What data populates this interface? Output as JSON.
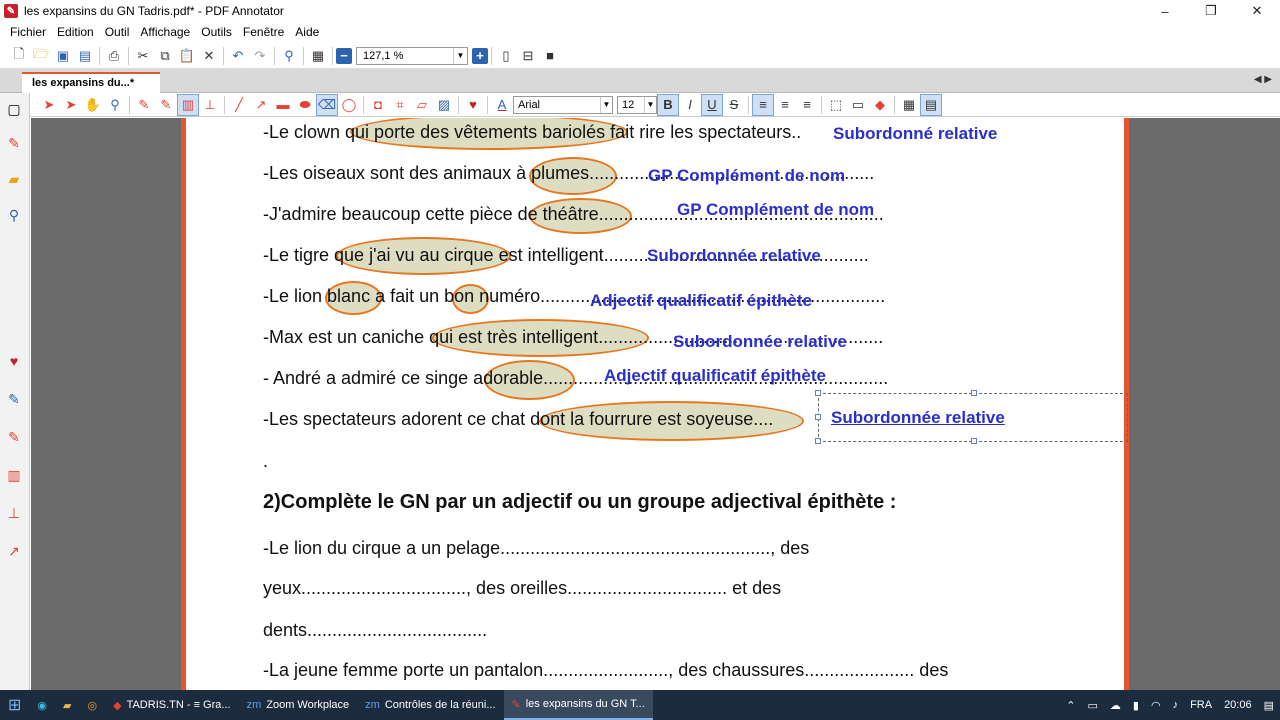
{
  "window": {
    "title": "les expansins du GN Tadris.pdf* - PDF Annotator",
    "controls": [
      "–",
      "❐",
      "✕"
    ]
  },
  "menu": [
    "Fichier",
    "Edition",
    "Outil",
    "Affichage",
    "Outils",
    "Fenêtre",
    "Aide"
  ],
  "toolbar": {
    "zoom_value": "127,1 %",
    "font_name": "Arial",
    "font_size": "12",
    "bold": "B",
    "italic": "I",
    "underline": "U",
    "strike": "S"
  },
  "tab": {
    "label": "les expansins du...*"
  },
  "document": {
    "lines": [
      "-Le clown qui porte des vêtements bariolés fait rire les spectateurs..",
      "-Les oiseaux sont des animaux à plumes.........................................................",
      "-J'admire beaucoup cette pièce de théâtre.........................................................",
      "-Le tigre que j'ai vu au cirque est intelligent.....................................................",
      "-Le lion blanc a fait un bon numéro.....................................................................",
      "-Max est un caniche qui est très intelligent.........................................................",
      "- André a admiré ce singe adorable.....................................................................",
      "-Les spectateurs adorent ce chat dont la fourrure est soyeuse....",
      "."
    ],
    "annotations": [
      "Subordonné relative",
      "GP Complément de nom",
      "GP Complément de nom",
      "Subordonnée relative",
      "Adjectif qualificatif épithète",
      "Subordonnée relative",
      "Adjectif qualificatif épithète",
      "Subordonnée relative"
    ],
    "heading": "2)Complète le GN par un adjectif ou un groupe adjectival épithète :",
    "exercise": [
      "-Le lion du cirque a un pelage......................................................, des",
      "yeux................................., des oreilles................................ et des",
      "dents....................................",
      "-La jeune femme  porte un pantalon........................., des chaussures...................... des"
    ]
  },
  "taskbar": {
    "apps": [
      "TADRIS.TN - ≡ Gra...",
      "Zoom Workplace",
      "Contrôles de la réuni...",
      "les expansins du GN T..."
    ],
    "lang": "FRA",
    "time": "20:06"
  }
}
